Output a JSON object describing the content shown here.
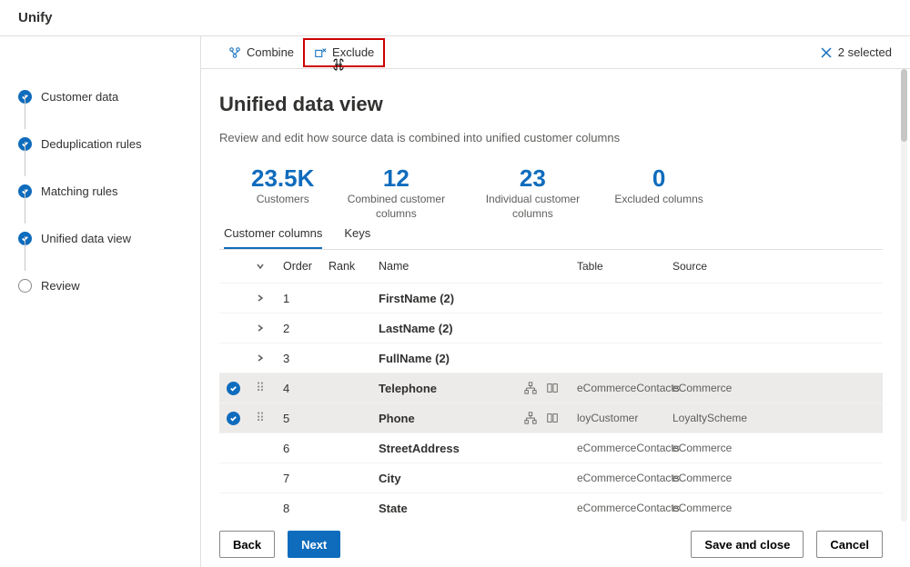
{
  "title": "Unify",
  "sidebar": {
    "items": [
      {
        "label": "Customer data",
        "state": "done"
      },
      {
        "label": "Deduplication rules",
        "state": "done"
      },
      {
        "label": "Matching rules",
        "state": "done"
      },
      {
        "label": "Unified data view",
        "state": "done"
      },
      {
        "label": "Review",
        "state": "pending"
      }
    ]
  },
  "toolbar": {
    "combine": "Combine",
    "exclude": "Exclude",
    "selected": "2 selected"
  },
  "page": {
    "heading": "Unified data view",
    "subtitle": "Review and edit how source data is combined into unified customer columns"
  },
  "stats": [
    {
      "value": "23.5K",
      "label": "Customers"
    },
    {
      "value": "12",
      "label": "Combined customer columns"
    },
    {
      "value": "23",
      "label": "Individual customer columns"
    },
    {
      "value": "0",
      "label": "Excluded columns"
    }
  ],
  "tabs": {
    "customer_columns": "Customer columns",
    "keys": "Keys"
  },
  "columns": {
    "order": "Order",
    "rank": "Rank",
    "name": "Name",
    "table": "Table",
    "source": "Source"
  },
  "rows": [
    {
      "expand": true,
      "order": "1",
      "name": "FirstName (2)"
    },
    {
      "expand": true,
      "order": "2",
      "name": "LastName (2)"
    },
    {
      "expand": true,
      "order": "3",
      "name": "FullName (2)"
    },
    {
      "selected": true,
      "drag": true,
      "order": "4",
      "name": "Telephone",
      "icons": true,
      "table": "eCommerceContacts",
      "source": "eCommerce"
    },
    {
      "selected": true,
      "drag": true,
      "order": "5",
      "name": "Phone",
      "icons": true,
      "table": "loyCustomer",
      "source": "LoyaltyScheme"
    },
    {
      "order": "6",
      "name": "StreetAddress",
      "table": "eCommerceContacts",
      "source": "eCommerce"
    },
    {
      "order": "7",
      "name": "City",
      "table": "eCommerceContacts",
      "source": "eCommerce"
    },
    {
      "order": "8",
      "name": "State",
      "table": "eCommerceContacts",
      "source": "eCommerce"
    }
  ],
  "footer": {
    "back": "Back",
    "next": "Next",
    "save": "Save and close",
    "cancel": "Cancel"
  }
}
